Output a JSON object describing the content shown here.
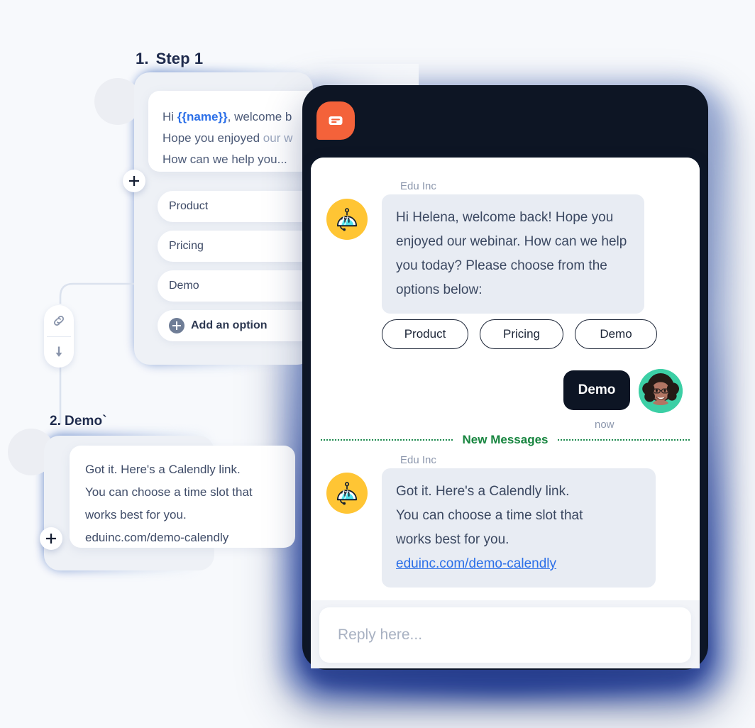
{
  "flow": {
    "step1": {
      "number": "1.",
      "title": "Step 1"
    },
    "step2": {
      "number": "2.",
      "title": "Demo`"
    },
    "message_card": {
      "line1_prefix": "Hi ",
      "line1_variable": "{{name}}",
      "line1_suffix": ", welcome b",
      "line2_strong": "Hope you enjoyed ",
      "line2_faded": "our w",
      "line3": "How can we help you..."
    },
    "options": [
      {
        "label": "Product"
      },
      {
        "label": "Pricing"
      },
      {
        "label": "Demo"
      }
    ],
    "add_option_label": "Add an option",
    "demo_card": {
      "line1": "Got it. Here's a Calendly link.",
      "line2": "You can choose a time slot that",
      "line3": "works best for you.",
      "line4": "eduinc.com/demo-calendly"
    },
    "connector_icons": {
      "link": "link-icon",
      "arrow": "arrow-down-icon"
    },
    "add_node_label": "+"
  },
  "phone": {
    "logo_icon": "chat-bubble-logo-icon",
    "chat": {
      "bot_name": "Edu Inc",
      "bot_avatar_icon": "robot-avatar-icon",
      "message1": "Hi Helena, welcome back! Hope you enjoyed our webinar. How can we help you today? Please choose from the options below:",
      "quick_replies": [
        {
          "label": "Product"
        },
        {
          "label": "Pricing"
        },
        {
          "label": "Demo"
        }
      ],
      "user_reply": "Demo",
      "user_avatar_icon": "user-photo-avatar",
      "timestamp": "now",
      "divider_label": "New Messages",
      "bot_name2": "Edu Inc",
      "message2_line1": "Got it. Here's a Calendly link.",
      "message2_line2": "You can choose a time slot that",
      "message2_line3": "works best for you.",
      "message2_link": "eduinc.com/demo-calendly"
    },
    "reply_placeholder": "Reply here..."
  },
  "colors": {
    "accent_orange": "#f4623a",
    "dark": "#0d1524",
    "link_blue": "#2b6fe8",
    "variable_blue": "#2b6fe8",
    "new_messages_green": "#17853f",
    "bot_avatar_yellow": "#ffc534",
    "user_avatar_teal": "#3ccfa5",
    "bubble_gray": "#e8ecf3",
    "page_bg": "#f7f9fc"
  }
}
